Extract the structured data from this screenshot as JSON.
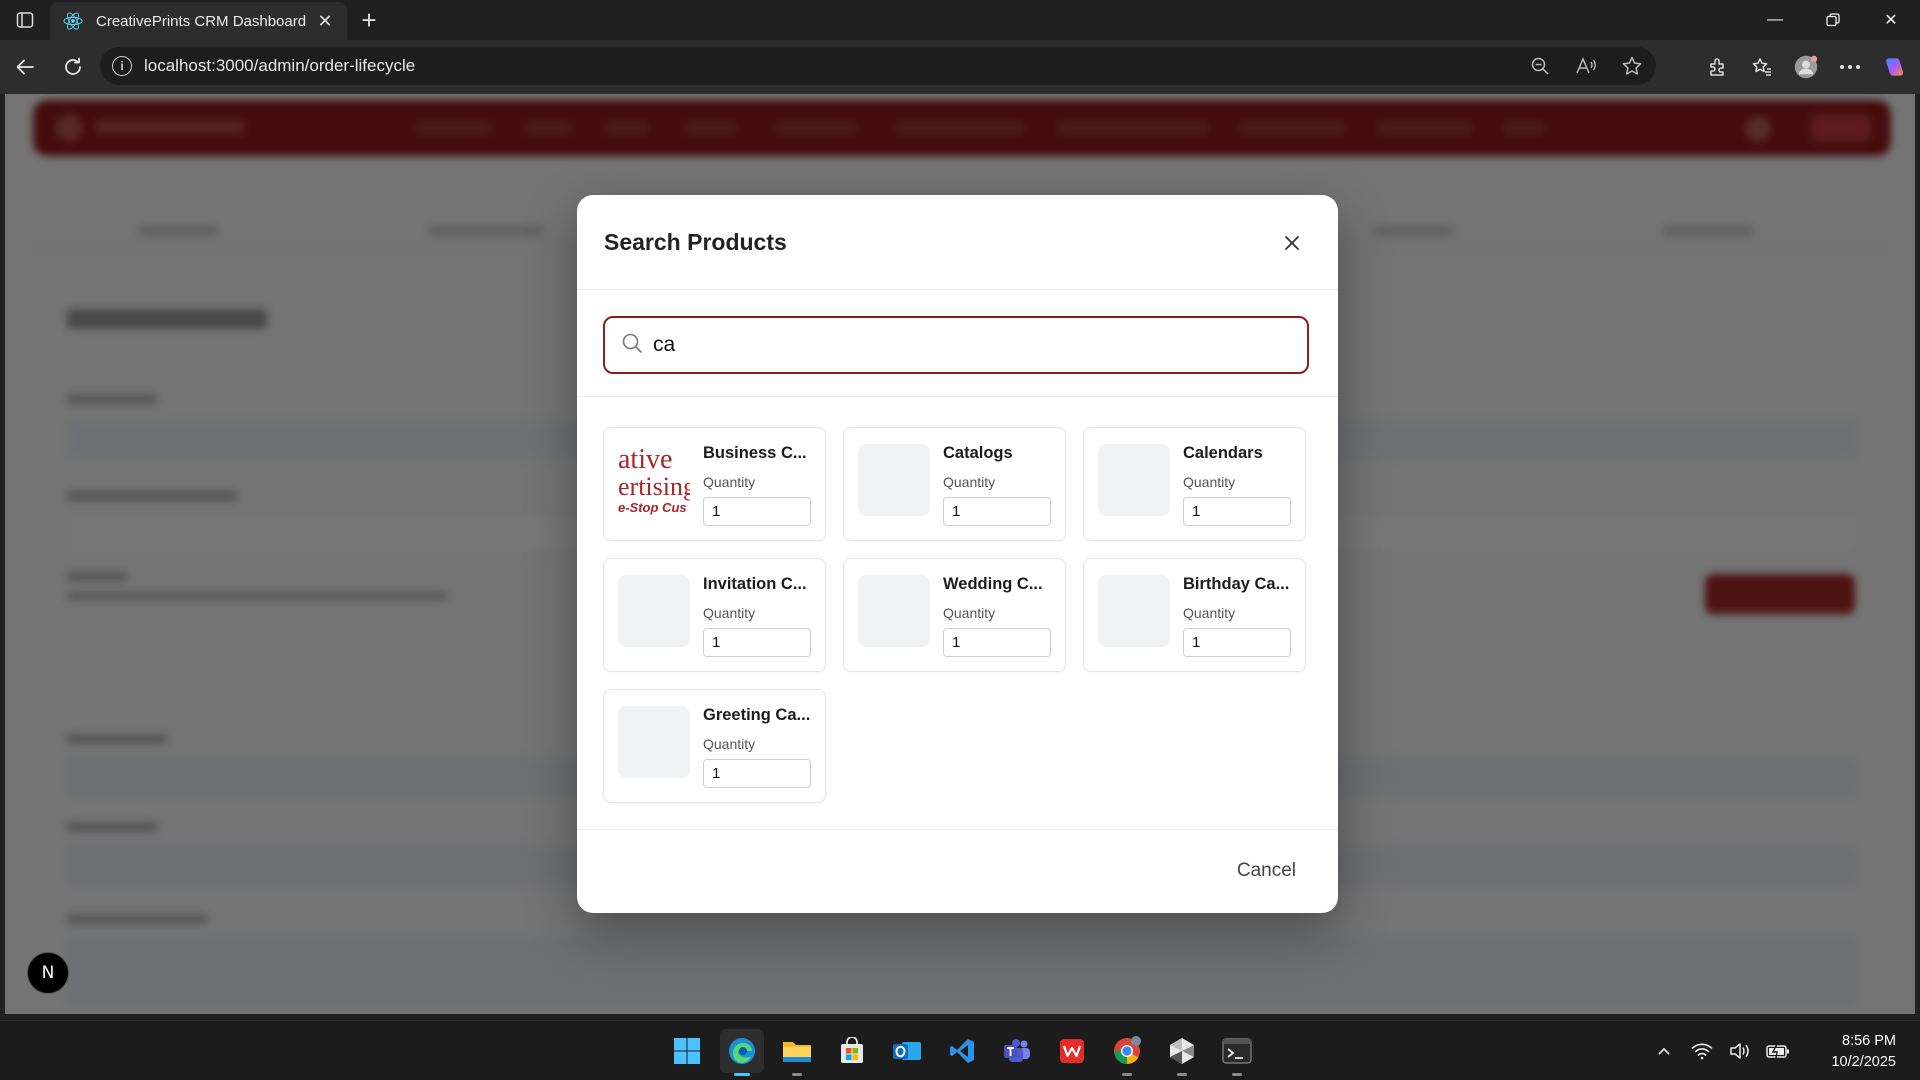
{
  "browser": {
    "tab_title": "CreativePrints CRM Dashboard",
    "url": "localhost:3000/admin/order-lifecycle"
  },
  "modal": {
    "title": "Search Products",
    "search_value": "ca",
    "cancel_label": "Cancel",
    "quantity_label": "Quantity",
    "products": [
      {
        "name": "Business C...",
        "quantity": "1",
        "thumb_lines": [
          "ative",
          "ertising",
          "e-Stop Cus"
        ]
      },
      {
        "name": "Catalogs",
        "quantity": "1"
      },
      {
        "name": "Calendars",
        "quantity": "1"
      },
      {
        "name": "Invitation C...",
        "quantity": "1"
      },
      {
        "name": "Wedding C...",
        "quantity": "1"
      },
      {
        "name": "Birthday Ca...",
        "quantity": "1"
      },
      {
        "name": "Greeting Ca...",
        "quantity": "1"
      }
    ]
  },
  "dev_badge": "N",
  "taskbar": {
    "time": "8:56 PM",
    "date": "10/2/2025",
    "apps": [
      "windows-start",
      "edge",
      "file-explorer",
      "microsoft-store",
      "outlook",
      "vscode",
      "teams",
      "wps-office",
      "chrome",
      "cursor",
      "terminal"
    ]
  },
  "colors": {
    "brand": "#8e1b1b",
    "search_border": "#8b1e1e"
  }
}
